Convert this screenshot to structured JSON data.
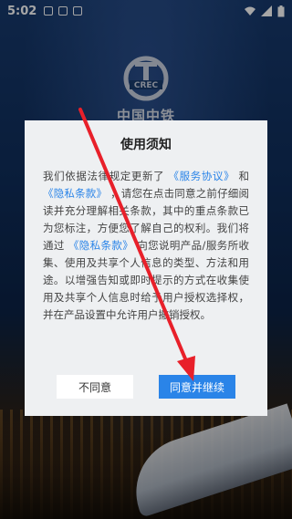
{
  "status_bar": {
    "time": "5:02"
  },
  "brand": {
    "name": "中国中铁"
  },
  "dialog": {
    "title": "使用须知",
    "body": {
      "p1": "我们依据法律规定更新了",
      "link_service": "《服务协议》",
      "p2": "和",
      "link_privacy1": "《隐私条款》",
      "p3": "，请您在点击同意之前仔细阅读并充分理解相关条款，其中的重点条款已为您标注，方便您了解自己的权利。我们将通过",
      "link_privacy2": "《隐私条款》",
      "p4": "向您说明产品/服务所收集、使用及共享个人信息的类型、方法和用途。以增强告知或即时提示的方式在收集使用及共享个人信息时给予用户授权选择权，并在产品设置中允许用户撤销授权。"
    },
    "decline_label": "不同意",
    "accept_label": "同意并继续"
  },
  "colors": {
    "accent": "#2a84e8",
    "arrow": "#e8202a"
  }
}
